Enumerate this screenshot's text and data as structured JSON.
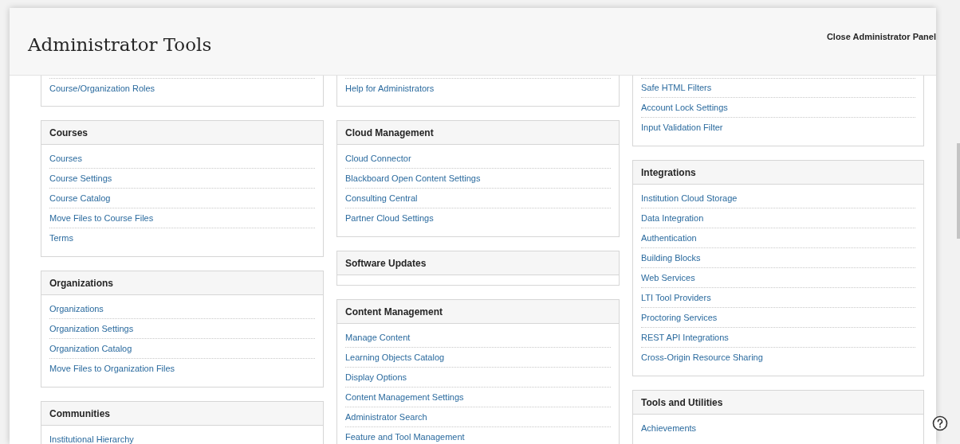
{
  "header": {
    "title": "Administrator Tools",
    "close_button": "Close Administrator Panel"
  },
  "columns": [
    [
      {
        "items": [
          "Course/Organization Roles"
        ]
      },
      {
        "title": "Courses",
        "items": [
          "Courses",
          "Course Settings",
          "Course Catalog",
          "Move Files to Course Files",
          "Terms"
        ]
      },
      {
        "title": "Organizations",
        "items": [
          "Organizations",
          "Organization Settings",
          "Organization Catalog",
          "Move Files to Organization Files"
        ]
      },
      {
        "title": "Communities",
        "items": [
          "Institutional Hierarchy"
        ]
      }
    ],
    [
      {
        "items": [
          "Help for Administrators"
        ]
      },
      {
        "title": "Cloud Management",
        "items": [
          "Cloud Connector",
          "Blackboard Open Content Settings",
          "Consulting Central",
          "Partner Cloud Settings"
        ]
      },
      {
        "title": "Software Updates"
      },
      {
        "title": "Content Management",
        "items": [
          "Manage Content",
          "Learning Objects Catalog",
          "Display Options",
          "Content Management Settings",
          "Administrator Search",
          "Feature and Tool Management"
        ]
      }
    ],
    [
      {
        "items": [
          "Safe HTML Filters",
          "Account Lock Settings",
          "Input Validation Filter"
        ]
      },
      {
        "title": "Integrations",
        "items": [
          "Institution Cloud Storage",
          "Data Integration",
          "Authentication",
          "Building Blocks",
          "Web Services",
          "LTI Tool Providers",
          "Proctoring Services",
          "REST API Integrations",
          "Cross-Origin Resource Sharing"
        ]
      },
      {
        "title": "Tools and Utilities",
        "items": [
          "Achievements"
        ]
      }
    ]
  ]
}
